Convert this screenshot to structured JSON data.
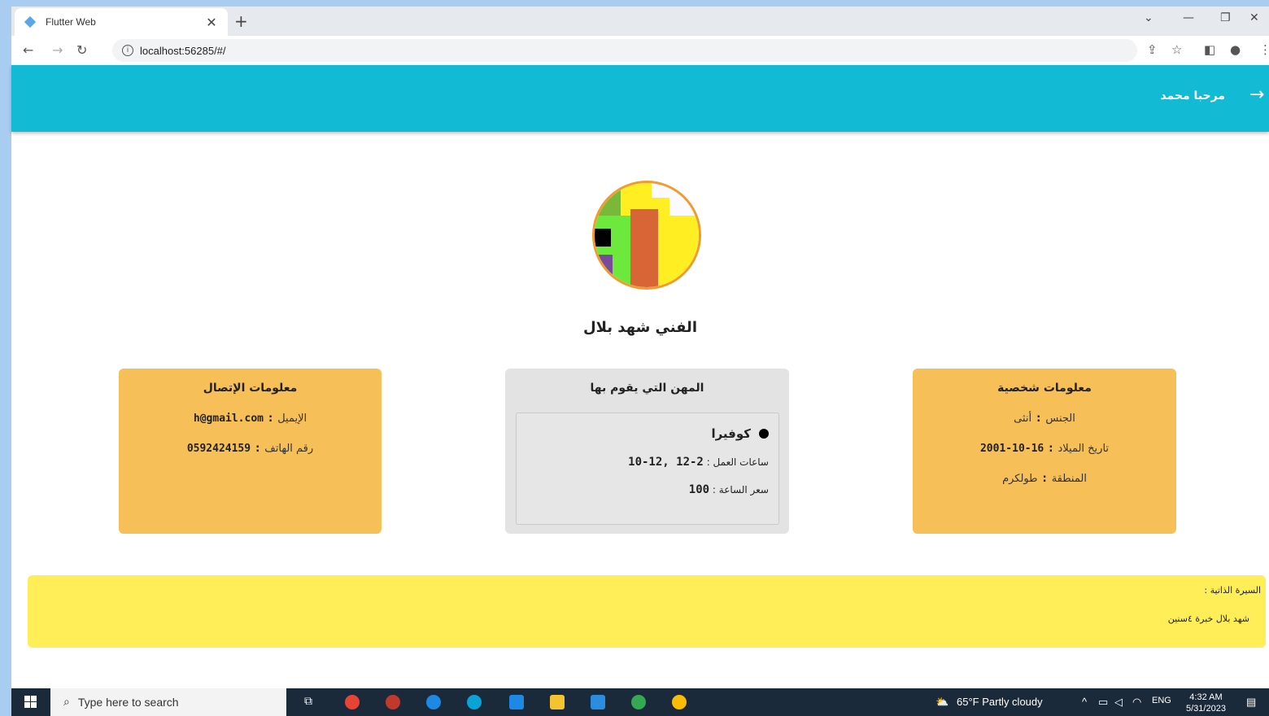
{
  "browser": {
    "tab_title": "Flutter Web",
    "url": "localhost:56285/#/"
  },
  "appbar": {
    "greeting": "مرحبا محمد"
  },
  "profile": {
    "name": "الفني شهد بلال"
  },
  "contact": {
    "title": "معلومات الإتصال",
    "email_label": "الإيميل",
    "email": "h@gmail.com",
    "phone_label": "رقم الهاتف",
    "phone": "0592424159",
    "colon": ":"
  },
  "jobs": {
    "title": "المهن التي يقوم بها",
    "items": [
      {
        "name": "كوفيرا",
        "hours_label": "ساعات العمل :",
        "hours": "10-12, 12-2",
        "price_label": "سعر الساعة :",
        "price": "100"
      }
    ]
  },
  "personal": {
    "title": "معلومات شخصية",
    "gender_label": "الجنس",
    "gender": "أنثى",
    "birth_label": "تاريخ الميلاد",
    "birth": "2001-10-16",
    "region_label": "المنطقة",
    "region": "طولكرم",
    "colon": ":"
  },
  "bio": {
    "title": "السيرة الذاتية :",
    "text": "شهد بلال خبرة ٤سنين"
  },
  "taskbar": {
    "search_placeholder": "Type here to search",
    "weather": "65°F  Partly cloudy",
    "lang": "ENG",
    "time": "4:32 AM",
    "date": "5/31/2023"
  },
  "colors": {
    "appbar": "#13bad4",
    "card_orange": "#f6bf58",
    "card_gray": "#e3e3e3",
    "bio_bg": "#ffee57"
  }
}
